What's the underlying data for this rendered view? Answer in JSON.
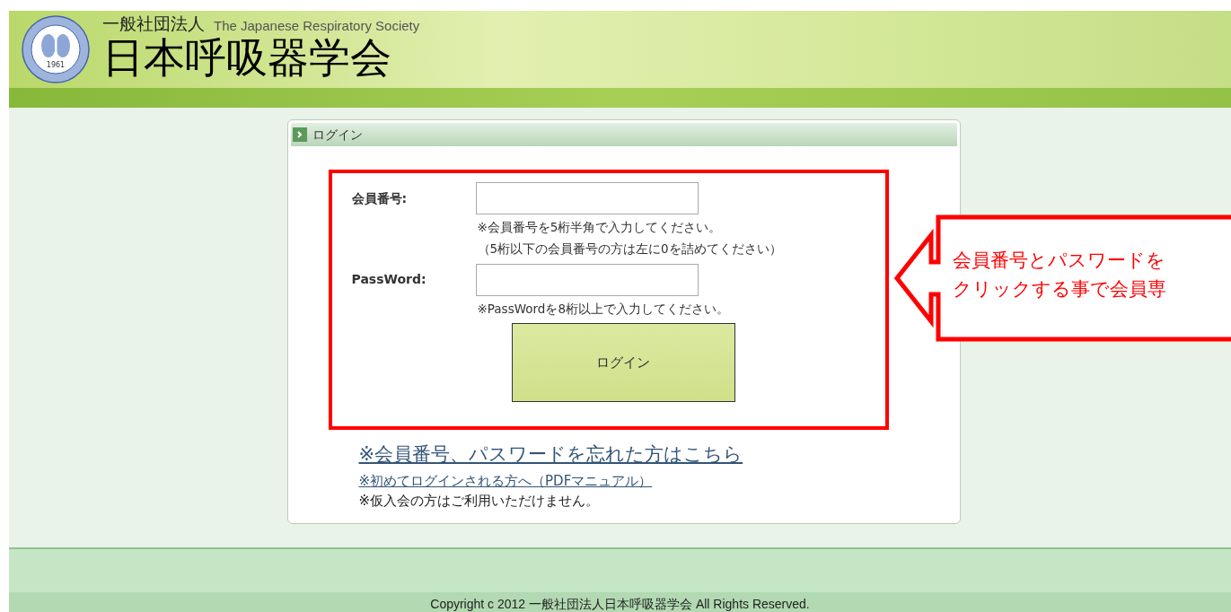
{
  "header": {
    "logo_year": "1961",
    "org_type": "一般社団法人",
    "org_name_en": "The Japanese Respiratory Society",
    "org_name": "日本呼吸器学会"
  },
  "login_panel": {
    "title": "ログイン",
    "fields": [
      {
        "label": "会員番号:",
        "notes": [
          "※会員番号を5桁半角で入力してください。",
          "（5桁以下の会員番号の方は左に0を詰めてください）"
        ]
      },
      {
        "label": "PassWord:",
        "notes": [
          "※PassWordを8桁以上で入力してください。"
        ]
      }
    ],
    "button": "ログイン",
    "forgot_link": "※会員番号、パスワードを忘れた方はこちら",
    "manual_link": "※初めてログインされる方へ（PDFマニュアル）",
    "note": "※仮入会の方はご利用いただけません。"
  },
  "callout": {
    "lines": [
      "会員番号とパスワードを",
      "クリックする事で会員専"
    ]
  },
  "footer": {
    "copyright": "Copyright c 2012 一般社団法人日本呼吸器学会 All Rights Reserved."
  }
}
